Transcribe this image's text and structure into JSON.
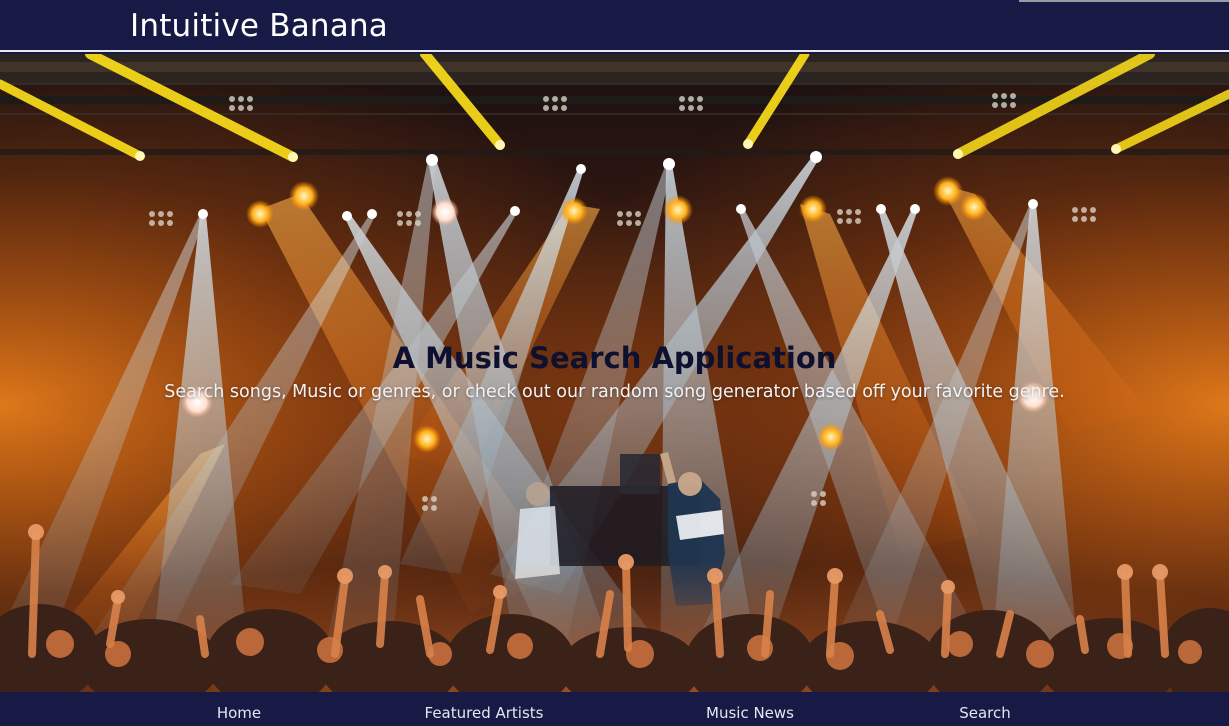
{
  "header": {
    "brand": "Intuitive Banana"
  },
  "hero": {
    "title": "A Music Search Application",
    "subtitle": "Search songs, Music or genres, or check out our random song generator based off your favorite genre.",
    "background": "concert-crowd-stage-lights-photo"
  },
  "nav": {
    "items": [
      {
        "label": "Home"
      },
      {
        "label": "Featured Artists"
      },
      {
        "label": "Music News"
      },
      {
        "label": "Search"
      }
    ]
  },
  "colors": {
    "navy": "#161a45",
    "title_text": "#0e1030",
    "light_text": "#f2f2f6",
    "beam_blue": "#bfe6ff",
    "beam_orange": "#ff8a1c",
    "beam_yellow": "#ffe11a"
  }
}
